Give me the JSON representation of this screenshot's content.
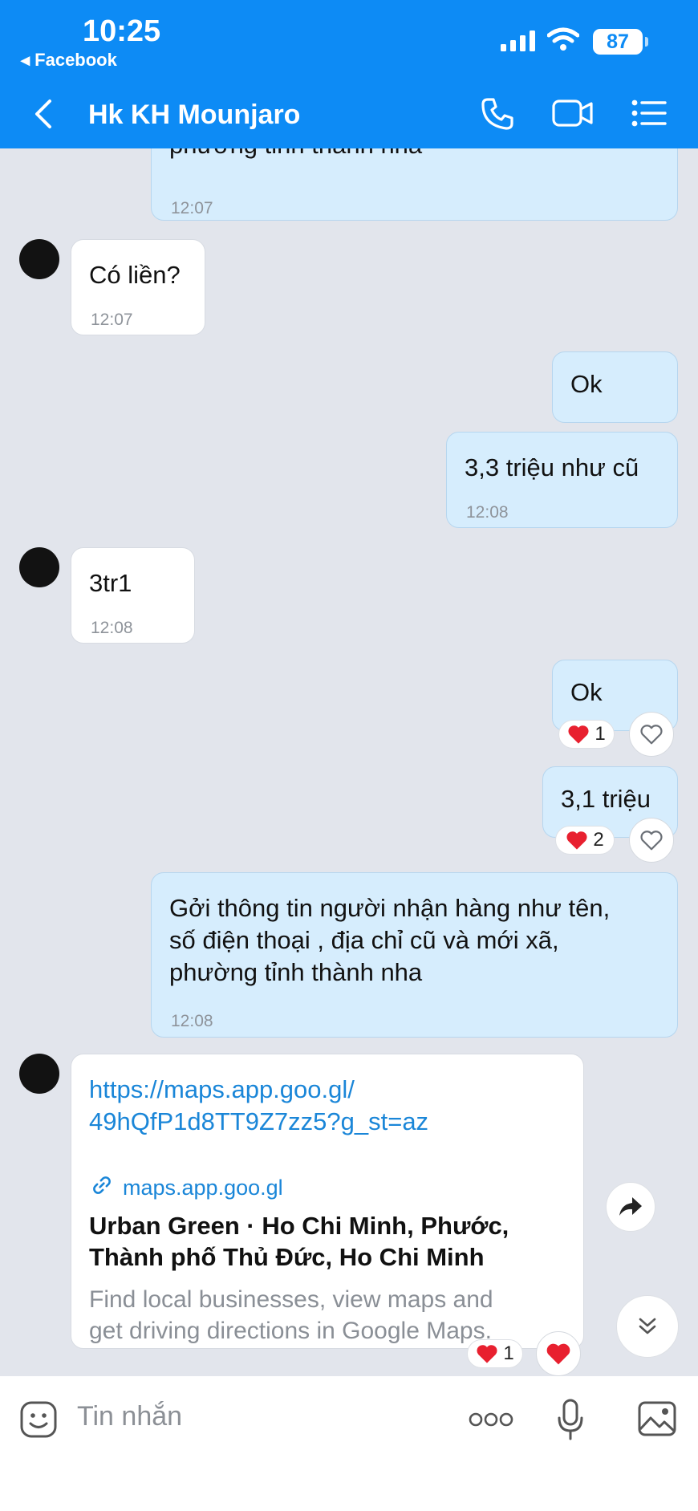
{
  "status_bar": {
    "time": "10:25",
    "back_app": "◂ Facebook",
    "battery": "87"
  },
  "header": {
    "title": "Hk KH Mounjaro"
  },
  "messages": [
    {
      "text": "phường tỉnh thành nha",
      "time": "12:07"
    },
    {
      "text": "Có liền?",
      "time": "12:07"
    },
    {
      "text": "Ok"
    },
    {
      "text": "3,3 triệu như cũ",
      "time": "12:08"
    },
    {
      "text": "3tr1",
      "time": "12:08"
    },
    {
      "text": "Ok",
      "reaction_count": "1"
    },
    {
      "text": "3,1 triệu",
      "reaction_count": "2"
    },
    {
      "lines": [
        "Gởi thông tin người nhận hàng như tên,",
        "số điện thoại , địa chỉ cũ và mới xã,",
        "phường tỉnh thành nha"
      ],
      "time": "12:08"
    },
    {
      "link_lines": [
        "https://maps.app.goo.gl/",
        "49hQfP1d8TT9Z7zz5?g_st=az"
      ],
      "preview": {
        "domain": "maps.app.goo.gl",
        "title_lines": [
          "Urban Green · Ho Chi Minh, Phước,",
          "Thành phố Thủ Đức, Ho Chi Minh"
        ],
        "desc_lines": [
          "Find local businesses, view maps and",
          "get driving directions in Google Maps."
        ]
      },
      "reaction_count": "1"
    }
  ],
  "composer": {
    "placeholder": "Tin nhắn"
  },
  "colors": {
    "header_bg": "#0d8bf5",
    "chat_bg": "#e2e5ec",
    "my_bubble": "#d6edfd",
    "their_bubble": "#ffffff",
    "link": "#1a86d8",
    "heart": "#e8202f"
  },
  "icons": [
    "back-chevron-icon",
    "phone-icon",
    "video-call-icon",
    "menu-list-icon",
    "heart-outline-icon",
    "heart-filled-icon",
    "share-arrow-icon",
    "chevron-double-down-icon",
    "sticker-icon",
    "more-dots-icon",
    "microphone-icon",
    "image-icon",
    "link-icon"
  ]
}
